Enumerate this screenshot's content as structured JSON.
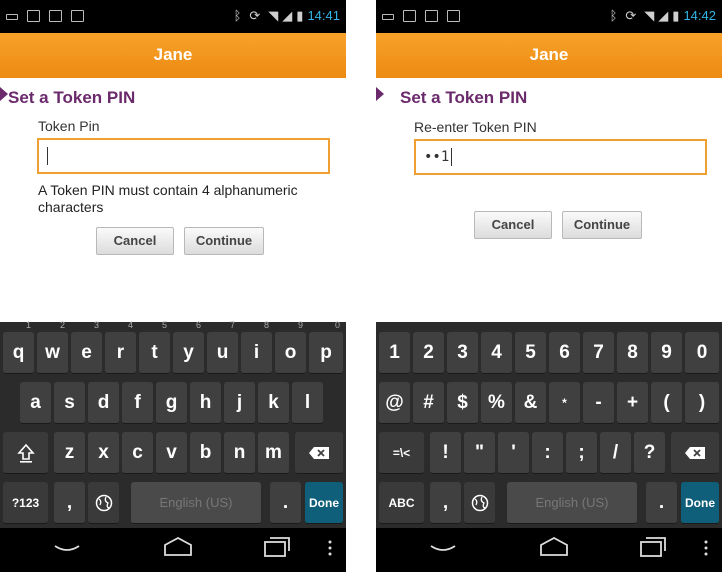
{
  "screens": [
    {
      "status": {
        "time": "14:41"
      },
      "app_title": "Jane",
      "section_title": "Set a Token PIN",
      "field_label": "Token Pin",
      "input_value": "",
      "hint": "A Token PIN must contain 4 alphanumeric characters",
      "buttons": {
        "cancel": "Cancel",
        "continue": "Continue"
      },
      "keyboard": {
        "layout": "alpha",
        "row1": [
          {
            "k": "q",
            "s": "1"
          },
          {
            "k": "w",
            "s": "2"
          },
          {
            "k": "e",
            "s": "3"
          },
          {
            "k": "r",
            "s": "4"
          },
          {
            "k": "t",
            "s": "5"
          },
          {
            "k": "y",
            "s": "6"
          },
          {
            "k": "u",
            "s": "7"
          },
          {
            "k": "i",
            "s": "8"
          },
          {
            "k": "o",
            "s": "9"
          },
          {
            "k": "p",
            "s": "0"
          }
        ],
        "row2": [
          "a",
          "s",
          "d",
          "f",
          "g",
          "h",
          "j",
          "k",
          "l"
        ],
        "row3": [
          "z",
          "x",
          "c",
          "v",
          "b",
          "n",
          "m"
        ],
        "mode_key": "?123",
        "comma_key": ",",
        "space_label": "English (US)",
        "period_key": ".",
        "done_key": "Done"
      }
    },
    {
      "status": {
        "time": "14:42"
      },
      "app_title": "Jane",
      "section_title": "Set a Token PIN",
      "field_label": "Re-enter Token PIN",
      "input_value": "••1",
      "hint": "",
      "buttons": {
        "cancel": "Cancel",
        "continue": "Continue"
      },
      "keyboard": {
        "layout": "symbols",
        "row1": [
          "1",
          "2",
          "3",
          "4",
          "5",
          "6",
          "7",
          "8",
          "9",
          "0"
        ],
        "row2": [
          "@",
          "#",
          "$",
          "%",
          "&",
          "*",
          "-",
          "+",
          "(",
          ")"
        ],
        "row3": [
          "!",
          "\"",
          "'",
          ":",
          ";",
          "/",
          "?"
        ],
        "alt_key": "=\\<",
        "mode_key": "ABC",
        "comma_key": ",",
        "space_label": "English (US)",
        "period_key": ".",
        "done_key": "Done"
      }
    }
  ],
  "icons": {
    "status": [
      "usb-icon",
      "image-icon",
      "play-store-icon",
      "play-store-icon"
    ],
    "status_right": [
      "bluetooth-icon",
      "sync-icon",
      "wifi-icon",
      "signal-icon",
      "battery-icon"
    ],
    "keyboard": [
      "shift-icon",
      "backspace-icon",
      "globe-icon"
    ],
    "nav": [
      "back-icon",
      "home-icon",
      "recents-icon",
      "menu-icon"
    ]
  },
  "colors": {
    "accent": "#f0a030",
    "title_bar": "#f39a20",
    "section_title": "#6b2a6b",
    "clock": "#33b5e5",
    "done_key": "#0f5f7a"
  }
}
